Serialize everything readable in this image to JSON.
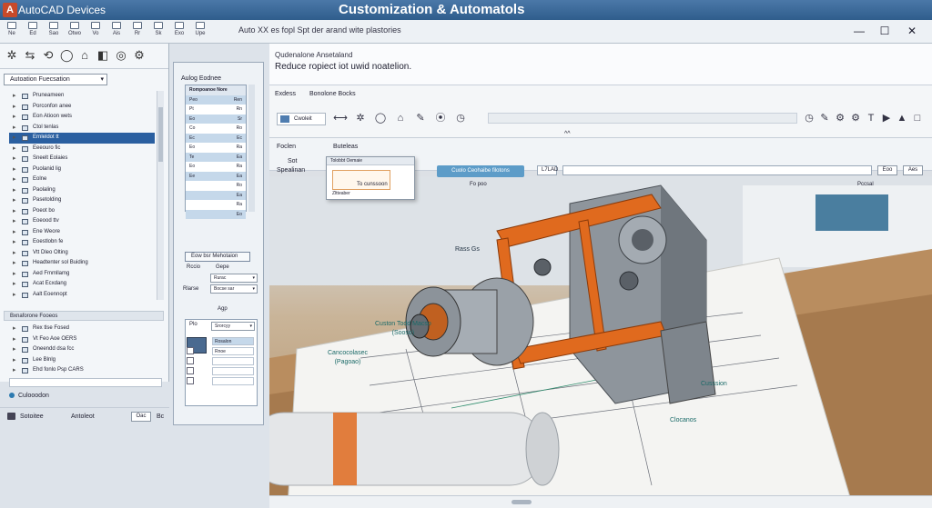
{
  "window": {
    "app_name": "AutoCAD Devices",
    "logo_letter": "A",
    "title": "Customization & Automatols",
    "info_text": "Auto XX es fopl Spt der arand wite plastories",
    "controls": {
      "minimize": "—",
      "maximize": "☐",
      "close": "✕"
    }
  },
  "menu": {
    "items": [
      {
        "label": "Ne",
        "icon": "new-icon"
      },
      {
        "label": "Ed",
        "icon": "edit-icon"
      },
      {
        "label": "Sao",
        "icon": "save-icon"
      },
      {
        "label": "Otwo",
        "icon": "open-icon"
      },
      {
        "label": "Vo",
        "icon": "view-icon"
      },
      {
        "label": "Ais",
        "icon": "insert-icon"
      },
      {
        "label": "Rr",
        "icon": "format-icon"
      },
      {
        "label": "Sk",
        "icon": "sketch-icon"
      },
      {
        "label": "Exo",
        "icon": "export-icon"
      },
      {
        "label": "Upe",
        "icon": "help-icon"
      }
    ]
  },
  "doc_header": {
    "title": "Qudenalone Ansetaland",
    "subtitle": "Reduce ropiect iot uwid noatelion."
  },
  "left_panel": {
    "tools": [
      "✲",
      "⇆",
      "⟲",
      "◯",
      "⌂",
      "◧",
      "◎",
      "⚙"
    ],
    "header": "Autoation Fuecsation",
    "tree": [
      {
        "label": "Pruneameen"
      },
      {
        "label": "Porconfon anee"
      },
      {
        "label": "Eon Atioon wets"
      },
      {
        "label": "Ctol tenlas"
      },
      {
        "label": "Ernleldot tt"
      },
      {
        "label": "Eeeouro fic"
      },
      {
        "label": "Sneelt Eolaies"
      },
      {
        "label": "Puolanid lig"
      },
      {
        "label": "Eolne"
      },
      {
        "label": "Paolaling"
      },
      {
        "label": "Pasetolding"
      },
      {
        "label": "Poeot bo"
      },
      {
        "label": "Eoeood ttv"
      },
      {
        "label": "Ene Weore"
      },
      {
        "label": "Eoestlobn fe"
      },
      {
        "label": "Vtt Dleo Olting"
      },
      {
        "label": "Headtenter sol Buiding"
      },
      {
        "label": "Aed Fmmllamg"
      },
      {
        "label": "Acat Ecxdang"
      },
      {
        "label": "Aalt Eoennopt"
      }
    ],
    "section2": "Bxnaforone Fooeos",
    "tree2": [
      {
        "label": "Rex tlse Fosed"
      },
      {
        "label": "Vt Feo Aoe OERS"
      },
      {
        "label": "Oneendd dsa fcc"
      },
      {
        "label": "Lee Blnlg"
      },
      {
        "label": "Ehd fonlo Psp CARS"
      }
    ],
    "footer1": "Culooodon",
    "footer2": {
      "label": "Sotoitee",
      "app": "Antoleot",
      "button": "Oac",
      "extra": "Bc"
    }
  },
  "mid_panel": {
    "header": "Aulog Eodnee",
    "list_title": "Rompoanoe Nore",
    "rows": [
      {
        "label": "Peo",
        "val": "Ren"
      },
      {
        "label": "Pt",
        "val": "Rn"
      },
      {
        "label": "Eo",
        "val": "Sr"
      },
      {
        "label": "Co",
        "val": "Ro"
      },
      {
        "label": "Ec",
        "val": "Ec"
      },
      {
        "label": "Eo",
        "val": "Ra"
      },
      {
        "label": "Te",
        "val": "Ea"
      },
      {
        "label": "Eo",
        "val": "Ra"
      },
      {
        "label": "Ee",
        "val": "Ea"
      },
      {
        "label": "",
        "val": "Ro"
      },
      {
        "label": "",
        "val": "Ea"
      },
      {
        "label": "",
        "val": "Ra"
      },
      {
        "label": "",
        "val": "Eo"
      }
    ],
    "new_button": "Eow bsr Mehotaion",
    "label_a": "Rccio",
    "label_b": "Gepe",
    "label_c": "Rlarse",
    "field_b": "Rurac",
    "field_c": "Bocse sar",
    "label_d": "Agp",
    "prop_lbl": "Plo",
    "prop_field": "Srorcyy",
    "prop_rows": [
      "Rosalon",
      "Rnoe",
      "",
      "",
      ""
    ]
  },
  "ribbon": {
    "tab1": "Exdess",
    "tab2": "Bonolone Bocks",
    "cmd": "Cwoleit",
    "tools_left": [
      "⟷",
      "✲",
      "◯",
      "⌂",
      "✎",
      "⦿",
      "◷"
    ],
    "tools_right": [
      "◷",
      "✎",
      "⚙",
      "⚙",
      "T",
      "▶",
      "▲",
      "□"
    ],
    "chevron": "^^"
  },
  "cmdbar": {
    "label1": "Foclen",
    "label2": "Buteleas",
    "sub1": "Sot",
    "sub2": "Spealinan",
    "active_tab": "Cuolo Ceohaibe filotons",
    "field_label": "L7LAD",
    "btn1": "Eoo",
    "btn2": "Aes"
  },
  "popup": {
    "header": "Tolobbt Oemaie",
    "footer": "Zltteaber"
  },
  "subbar": {
    "t1": "To cunssoon",
    "t2": "Fo poo",
    "t3": "Pccsal"
  },
  "callouts": {
    "c1": "Custon Todd Macso\n(Sooso)",
    "c2": "Cancocolasec\n(Pagoao)",
    "c3": "Cusssion",
    "c4": "Clocanos",
    "c5": "Rass Gs"
  },
  "colors": {
    "accent": "#2f5d8c",
    "selection": "#2a5fa0",
    "machine_orange": "#e06a1e",
    "machine_gray": "#8c949c",
    "callout": "#1a6a68"
  }
}
